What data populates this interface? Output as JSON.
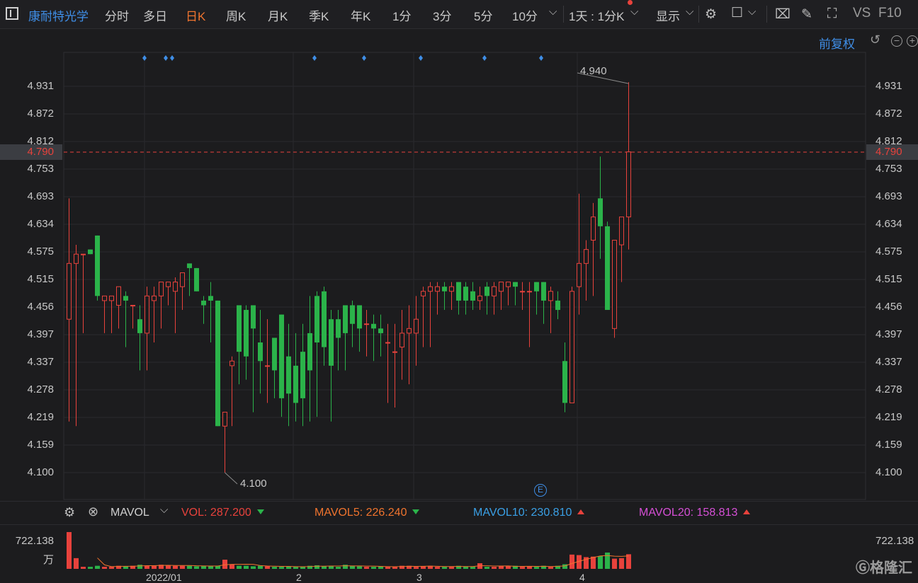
{
  "toolbar": {
    "stock_name": "康耐特光学",
    "tabs": [
      "分时",
      "多日",
      "日K",
      "周K",
      "月K",
      "季K",
      "年K",
      "1分",
      "3分",
      "5分",
      "10分"
    ],
    "active_tab": "日K",
    "period_select": "1天 : 1分K",
    "display_label": "显示",
    "vs_label": "VS",
    "f10_label": "F10"
  },
  "adjust_label": "前复权",
  "current_price": "4.790",
  "y_ticks": [
    "4.931",
    "4.872",
    "4.812",
    "4.753",
    "4.693",
    "4.634",
    "4.575",
    "4.515",
    "4.456",
    "4.397",
    "4.337",
    "4.278",
    "4.219",
    "4.159",
    "4.100"
  ],
  "indicator": {
    "name": "MAVOL",
    "vol_label": "VOL:",
    "vol_value": "287.200",
    "mavol5_label": "MAVOL5:",
    "mavol5_value": "226.240",
    "mavol10_label": "MAVOL10:",
    "mavol10_value": "230.810",
    "mavol20_label": "MAVOL20:",
    "mavol20_value": "158.813"
  },
  "vol_axis": {
    "value": "722.138",
    "unit": "万"
  },
  "x_labels": [
    "2022/01",
    "2",
    "3",
    "4"
  ],
  "watermark": "格隆汇",
  "colors": {
    "up": "#e8423c",
    "down": "#2bb34a",
    "accent": "#f0742e",
    "blue": "#3f8ee6",
    "mavol5": "#f0742e",
    "mavol10": "#3aa0e6",
    "mavol20": "#d64fd6"
  },
  "chart_data": {
    "type": "candlestick",
    "y_range": [
      4.1,
      4.931
    ],
    "high_annotation": "4.940",
    "low_annotation": "4.100",
    "event_marker": "E",
    "candles": [
      {
        "o": 4.43,
        "h": 4.69,
        "l": 4.21,
        "c": 4.55
      },
      {
        "o": 4.55,
        "h": 4.59,
        "l": 4.2,
        "c": 4.57
      },
      {
        "o": 4.57,
        "h": 4.57,
        "l": 4.4,
        "c": 4.57
      },
      {
        "o": 4.58,
        "h": 4.58,
        "l": 4.57,
        "c": 4.57
      },
      {
        "o": 4.61,
        "h": 4.61,
        "l": 4.47,
        "c": 4.48
      },
      {
        "o": 4.47,
        "h": 4.48,
        "l": 4.4,
        "c": 4.48
      },
      {
        "o": 4.47,
        "h": 4.48,
        "l": 4.4,
        "c": 4.48
      },
      {
        "o": 4.46,
        "h": 4.5,
        "l": 4.41,
        "c": 4.5
      },
      {
        "o": 4.48,
        "h": 4.49,
        "l": 4.37,
        "c": 4.47
      },
      {
        "o": 4.46,
        "h": 4.46,
        "l": 4.41,
        "c": 4.46
      },
      {
        "o": 4.43,
        "h": 4.46,
        "l": 4.32,
        "c": 4.4
      },
      {
        "o": 4.4,
        "h": 4.5,
        "l": 4.32,
        "c": 4.48
      },
      {
        "o": 4.47,
        "h": 4.5,
        "l": 4.38,
        "c": 4.48
      },
      {
        "o": 4.48,
        "h": 4.5,
        "l": 4.41,
        "c": 4.51
      },
      {
        "o": 4.5,
        "h": 4.51,
        "l": 4.46,
        "c": 4.51
      },
      {
        "o": 4.49,
        "h": 4.52,
        "l": 4.4,
        "c": 4.51
      },
      {
        "o": 4.5,
        "h": 4.53,
        "l": 4.45,
        "c": 4.53
      },
      {
        "o": 4.55,
        "h": 4.55,
        "l": 4.48,
        "c": 4.54
      },
      {
        "o": 4.54,
        "h": 4.54,
        "l": 4.49,
        "c": 4.49
      },
      {
        "o": 4.47,
        "h": 4.48,
        "l": 4.42,
        "c": 4.46
      },
      {
        "o": 4.48,
        "h": 4.51,
        "l": 4.38,
        "c": 4.47
      },
      {
        "o": 4.47,
        "h": 4.47,
        "l": 4.2,
        "c": 4.2
      },
      {
        "o": 4.2,
        "h": 4.23,
        "l": 4.1,
        "c": 4.23
      },
      {
        "o": 4.33,
        "h": 4.35,
        "l": 4.2,
        "c": 4.34
      },
      {
        "o": 4.46,
        "h": 4.46,
        "l": 4.29,
        "c": 4.36
      },
      {
        "o": 4.45,
        "h": 4.46,
        "l": 4.3,
        "c": 4.35
      },
      {
        "o": 4.46,
        "h": 4.46,
        "l": 4.23,
        "c": 4.41
      },
      {
        "o": 4.38,
        "h": 4.45,
        "l": 4.27,
        "c": 4.34
      },
      {
        "o": 4.33,
        "h": 4.43,
        "l": 4.25,
        "c": 4.33
      },
      {
        "o": 4.39,
        "h": 4.39,
        "l": 4.26,
        "c": 4.32
      },
      {
        "o": 4.44,
        "h": 4.44,
        "l": 4.22,
        "c": 4.26
      },
      {
        "o": 4.35,
        "h": 4.42,
        "l": 4.2,
        "c": 4.27
      },
      {
        "o": 4.33,
        "h": 4.4,
        "l": 4.21,
        "c": 4.25
      },
      {
        "o": 4.36,
        "h": 4.42,
        "l": 4.2,
        "c": 4.26
      },
      {
        "o": 4.4,
        "h": 4.48,
        "l": 4.21,
        "c": 4.32
      },
      {
        "o": 4.48,
        "h": 4.49,
        "l": 4.22,
        "c": 4.38
      },
      {
        "o": 4.49,
        "h": 4.5,
        "l": 4.33,
        "c": 4.37
      },
      {
        "o": 4.43,
        "h": 4.45,
        "l": 4.21,
        "c": 4.33
      },
      {
        "o": 4.43,
        "h": 4.45,
        "l": 4.32,
        "c": 4.39
      },
      {
        "o": 4.46,
        "h": 4.46,
        "l": 4.32,
        "c": 4.4
      },
      {
        "o": 4.46,
        "h": 4.47,
        "l": 4.37,
        "c": 4.42
      },
      {
        "o": 4.46,
        "h": 4.46,
        "l": 4.36,
        "c": 4.41
      },
      {
        "o": 4.42,
        "h": 4.45,
        "l": 4.35,
        "c": 4.42
      },
      {
        "o": 4.42,
        "h": 4.44,
        "l": 4.34,
        "c": 4.41
      },
      {
        "o": 4.41,
        "h": 4.44,
        "l": 4.35,
        "c": 4.4
      },
      {
        "o": 4.38,
        "h": 4.42,
        "l": 4.25,
        "c": 4.38
      },
      {
        "o": 4.36,
        "h": 4.42,
        "l": 4.24,
        "c": 4.36
      },
      {
        "o": 4.37,
        "h": 4.45,
        "l": 4.3,
        "c": 4.4
      },
      {
        "o": 4.4,
        "h": 4.46,
        "l": 4.29,
        "c": 4.41
      },
      {
        "o": 4.4,
        "h": 4.48,
        "l": 4.33,
        "c": 4.43
      },
      {
        "o": 4.48,
        "h": 4.5,
        "l": 4.37,
        "c": 4.49
      },
      {
        "o": 4.49,
        "h": 4.51,
        "l": 4.37,
        "c": 4.5
      },
      {
        "o": 4.49,
        "h": 4.51,
        "l": 4.44,
        "c": 4.5
      },
      {
        "o": 4.5,
        "h": 4.51,
        "l": 4.45,
        "c": 4.49
      },
      {
        "o": 4.49,
        "h": 4.51,
        "l": 4.45,
        "c": 4.5
      },
      {
        "o": 4.51,
        "h": 4.51,
        "l": 4.44,
        "c": 4.47
      },
      {
        "o": 4.5,
        "h": 4.51,
        "l": 4.44,
        "c": 4.47
      },
      {
        "o": 4.49,
        "h": 4.51,
        "l": 4.45,
        "c": 4.47
      },
      {
        "o": 4.47,
        "h": 4.5,
        "l": 4.45,
        "c": 4.48
      },
      {
        "o": 4.5,
        "h": 4.51,
        "l": 4.44,
        "c": 4.48
      },
      {
        "o": 4.48,
        "h": 4.51,
        "l": 4.44,
        "c": 4.5
      },
      {
        "o": 4.49,
        "h": 4.51,
        "l": 4.45,
        "c": 4.51
      },
      {
        "o": 4.5,
        "h": 4.51,
        "l": 4.46,
        "c": 4.51
      },
      {
        "o": 4.51,
        "h": 4.51,
        "l": 4.46,
        "c": 4.5
      },
      {
        "o": 4.49,
        "h": 4.51,
        "l": 4.45,
        "c": 4.49
      },
      {
        "o": 4.49,
        "h": 4.51,
        "l": 4.37,
        "c": 4.49
      },
      {
        "o": 4.51,
        "h": 4.51,
        "l": 4.44,
        "c": 4.49
      },
      {
        "o": 4.51,
        "h": 4.51,
        "l": 4.42,
        "c": 4.47
      },
      {
        "o": 4.47,
        "h": 4.5,
        "l": 4.4,
        "c": 4.49
      },
      {
        "o": 4.47,
        "h": 4.49,
        "l": 4.43,
        "c": 4.45
      },
      {
        "o": 4.34,
        "h": 4.38,
        "l": 4.23,
        "c": 4.25
      },
      {
        "o": 4.25,
        "h": 4.5,
        "l": 4.25,
        "c": 4.49
      },
      {
        "o": 4.5,
        "h": 4.7,
        "l": 4.44,
        "c": 4.55
      },
      {
        "o": 4.55,
        "h": 4.6,
        "l": 4.47,
        "c": 4.58
      },
      {
        "o": 4.6,
        "h": 4.68,
        "l": 4.48,
        "c": 4.65
      },
      {
        "o": 4.69,
        "h": 4.78,
        "l": 4.56,
        "c": 4.63
      },
      {
        "o": 4.63,
        "h": 4.64,
        "l": 4.45,
        "c": 4.45
      },
      {
        "o": 4.41,
        "h": 4.6,
        "l": 4.39,
        "c": 4.6
      },
      {
        "o": 4.59,
        "h": 4.65,
        "l": 4.51,
        "c": 4.65
      },
      {
        "o": 4.65,
        "h": 4.94,
        "l": 4.58,
        "c": 4.79
      }
    ],
    "volume_max": 722.138,
    "volumes": [
      722,
      210,
      40,
      40,
      60,
      40,
      40,
      60,
      50,
      60,
      80,
      60,
      60,
      80,
      70,
      60,
      60,
      60,
      50,
      60,
      50,
      60,
      180,
      90,
      60,
      60,
      50,
      60,
      50,
      40,
      40,
      50,
      40,
      40,
      60,
      70,
      50,
      60,
      40,
      80,
      60,
      50,
      40,
      40,
      50,
      40,
      40,
      60,
      60,
      40,
      50,
      60,
      40,
      40,
      40,
      60,
      50,
      40,
      110,
      40,
      40,
      50,
      50,
      60,
      40,
      50,
      40,
      60,
      40,
      60,
      90,
      280,
      270,
      230,
      240,
      250,
      320,
      200,
      210,
      287
    ]
  }
}
